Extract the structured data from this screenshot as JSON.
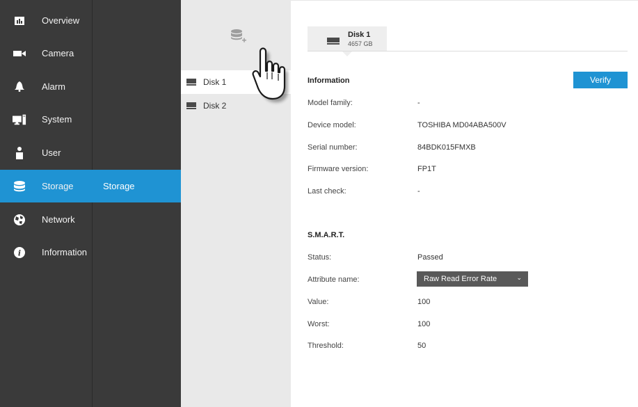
{
  "nav": {
    "items": [
      {
        "label": "Overview",
        "icon": "overview-icon"
      },
      {
        "label": "Camera",
        "icon": "camera-icon"
      },
      {
        "label": "Alarm",
        "icon": "alarm-icon"
      },
      {
        "label": "System",
        "icon": "system-icon"
      },
      {
        "label": "User",
        "icon": "user-icon"
      },
      {
        "label": "Storage",
        "icon": "storage-icon"
      },
      {
        "label": "Network",
        "icon": "network-icon"
      },
      {
        "label": "Information",
        "icon": "information-icon"
      }
    ],
    "active": "Storage"
  },
  "subnav": {
    "items": [
      {
        "label": "Storage"
      }
    ]
  },
  "disks": {
    "items": [
      {
        "label": "Disk 1"
      },
      {
        "label": "Disk 2"
      }
    ],
    "selected": "Disk 1"
  },
  "tab": {
    "title": "Disk 1",
    "subtitle": "4657 GB"
  },
  "information": {
    "title": "Information",
    "verify_label": "Verify",
    "rows": [
      {
        "label": "Model family:",
        "value": "-"
      },
      {
        "label": "Device model:",
        "value": "TOSHIBA MD04ABA500V"
      },
      {
        "label": "Serial number:",
        "value": "84BDK015FMXB"
      },
      {
        "label": "Firmware version:",
        "value": "FP1T"
      },
      {
        "label": "Last check:",
        "value": "-"
      }
    ]
  },
  "smart": {
    "title": "S.M.A.R.T.",
    "status_label": "Status:",
    "status_value": "Passed",
    "attribute_label": "Attribute name:",
    "attribute_value": "Raw Read Error Rate",
    "value_label": "Value:",
    "value_value": "100",
    "worst_label": "Worst:",
    "worst_value": "100",
    "threshold_label": "Threshold:",
    "threshold_value": "50"
  },
  "colors": {
    "accent": "#1f93d3",
    "sidebar": "#3a3a3a",
    "panel": "#e9e9e9"
  }
}
